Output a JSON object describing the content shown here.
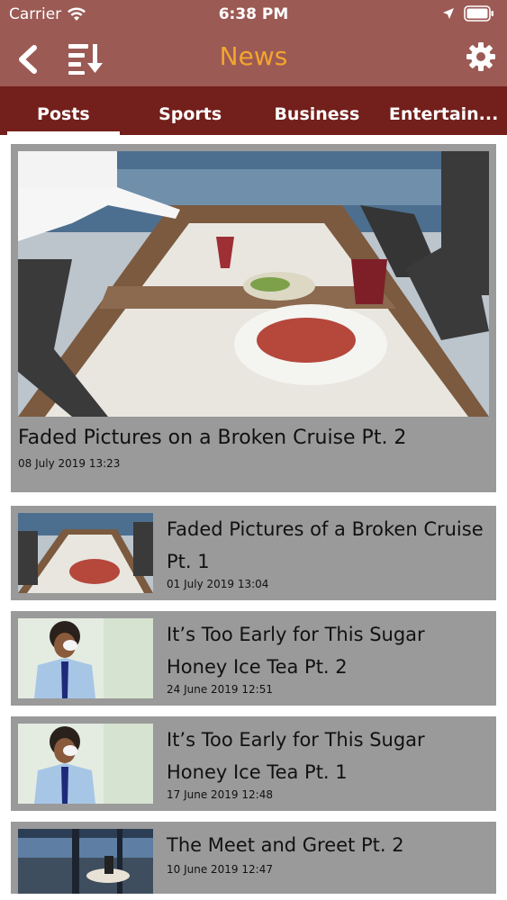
{
  "status": {
    "carrier": "Carrier",
    "time": "6:38 PM"
  },
  "nav": {
    "title": "News"
  },
  "tabs": [
    "Posts",
    "Sports",
    "Business",
    "Entertain..."
  ],
  "featured": {
    "title": "Faded Pictures on a Broken Cruise Pt. 2",
    "date": "08 July 2019 13:23"
  },
  "items": [
    {
      "title": "Faded Pictures of a Broken Cruise Pt. 1",
      "date": "01 July 2019 13:04"
    },
    {
      "title": "It’s Too Early for This Sugar Honey Ice Tea Pt. 2",
      "date": "24 June 2019 12:51"
    },
    {
      "title": "It’s Too Early for This Sugar Honey Ice Tea Pt. 1",
      "date": "17 June 2019 12:48"
    },
    {
      "title": "The Meet and Greet Pt. 2",
      "date": "10 June 2019 12:47"
    }
  ],
  "colors": {
    "bar": "#9c5a54",
    "tabs": "#731f1b",
    "title_accent": "#f3a52f",
    "card": "#9a9a9a"
  }
}
